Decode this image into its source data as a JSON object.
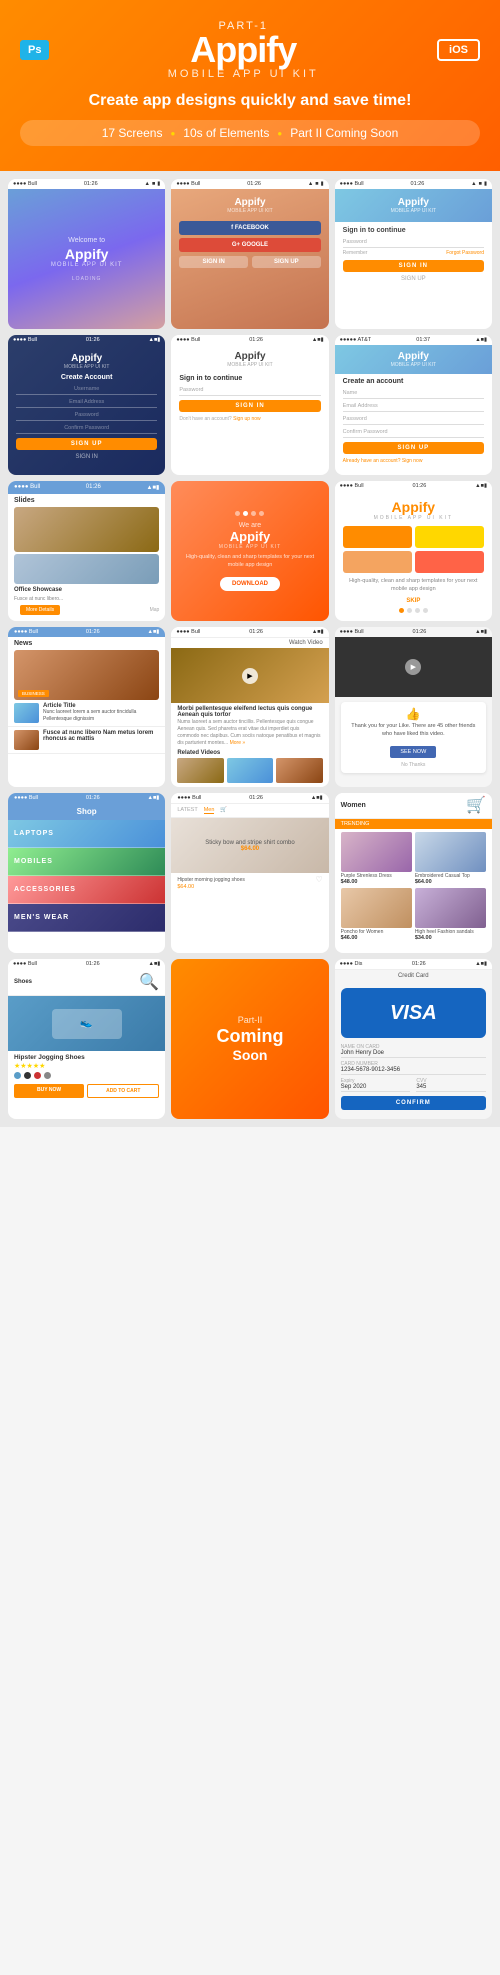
{
  "header": {
    "ps_badge": "Ps",
    "part_label": "PART-1",
    "brand_title": "Appify",
    "brand_subtitle": "MOBILE APP UI KIT",
    "ios_badge": "iOS",
    "tagline": "Create app designs quickly and save time!",
    "features": {
      "screens": "17 Screens",
      "elements": "10s of Elements",
      "coming_soon": "Part II Coming Soon"
    }
  },
  "screens": {
    "splash": {
      "welcome": "Welcome to",
      "title": "Appify",
      "kit": "MOBILE APP UI KIT",
      "loading": "LOADING"
    },
    "social_login": {
      "brand": "Appify",
      "kit": "MOBILE APP UI KIT",
      "facebook_btn": "f  FACEBOOK",
      "google_btn": "G+  GOOGLE",
      "sign_in": "SIGN IN",
      "sign_up": "SIGN UP"
    },
    "signin": {
      "brand": "Appify",
      "kit": "MOBILE APP UI KIT",
      "title": "Sign in to continue",
      "password_field": "Password",
      "remember": "Remember",
      "forgot": "Forgot Password",
      "sign_in_btn": "SIGN IN",
      "sign_up": "SIGN UP"
    },
    "create_account_dark": {
      "brand": "Appify",
      "kit": "MOBILE APP UI KIT",
      "title": "Create Account",
      "username": "Username",
      "email": "Email Address",
      "password": "Password",
      "confirm": "Confirm Password",
      "sign_up_btn": "SIGN UP",
      "sign_in": "SIGN IN"
    },
    "sign_in_white": {
      "brand": "Appify",
      "kit": "MOBILE APP UI KIT",
      "title": "Sign in to continue",
      "password_field": "Password",
      "sign_in_btn": "SIGN IN",
      "no_account": "Don't have an account?",
      "sign_up_link": "Sign up now"
    },
    "create_account_white": {
      "brand": "Appify",
      "kit": "MOBILE APP UI KIT",
      "title": "Create an account",
      "name_field": "Name",
      "email_field": "Email Address",
      "password_field": "Password",
      "confirm_field": "Confirm Password",
      "sign_up_btn": "SIGN UP",
      "already": "Already have an account?",
      "sign_now": "Sign now"
    },
    "slides": {
      "label": "Slides",
      "office": "Office Showcase",
      "more_details": "More Details",
      "map": "Map"
    },
    "download": {
      "we_are": "We are",
      "title": "Appify",
      "kit": "MOBILE APP UI KIT",
      "desc": "High-quality, clean and sharp templates for your next mobile app design",
      "download_btn": "DOWNLOAD"
    },
    "intro": {
      "title": "Appify",
      "kit": "MOBILE APP UI KIT",
      "desc": "High-quality, clean and sharp templates for your next mobile app design",
      "skip": "SKIP"
    },
    "news": {
      "label": "News",
      "business": "BUSINESS",
      "article1": "Nunc laoreet lorem a sem auctor tincidulla Pellentesque dignissim",
      "article2_title": "Fusce at nunc libero Nam metus lorem rhoncus ac mattis"
    },
    "video": {
      "watch": "Watch Video",
      "title": "Morbi pellentesque eleifend lectus quis congue Aenean quis tortor",
      "related": "Related Videos"
    },
    "like": {
      "thank_you": "Thank you for your Like. There are 45 other friends who have liked this video.",
      "see_now": "SEE NOW",
      "no_thanks": "No Thanks"
    },
    "shop": {
      "title": "Shop",
      "laptops": "LAPTOPS",
      "mobiles": "MOBILES",
      "accessories": "ACCESSORIES",
      "mens_wear": "MEN'S WEAR"
    },
    "men": {
      "title": "Men",
      "item": "Sticky bow and stripe shirt combo",
      "price": "$64.00"
    },
    "women": {
      "title": "Women",
      "trending": "TRENDING",
      "item1": "Purple Strenless Dress",
      "price1": "$48.00",
      "item2": "Embroidered Casual Top",
      "price2": "$64.00",
      "item3": "Poncho for Women",
      "price3": "$46.00",
      "item4": "High heel Fashion sandals",
      "price4": "$34.00"
    },
    "shoe": {
      "category": "Shoes",
      "name": "Hipster Jogging Shoes",
      "buy_now": "BUY NOW",
      "add_to_cart": "ADD TO CART"
    },
    "coming_soon": {
      "part": "Part-II",
      "title": "Coming",
      "soon": "Soon"
    },
    "credit_card": {
      "label": "Credit Card",
      "visa": "VISA",
      "name_label": "NAME ON CARD",
      "name_value": "John Henry Doe",
      "number_label": "CARD NUMBER",
      "number_value": "1234-5678-9012-3456",
      "expiry_label": "Expiry",
      "expiry_value": "Sep    2020",
      "cvv_label": "CVV",
      "cvv_value": "345",
      "confirm_btn": "CONFIRM"
    }
  }
}
